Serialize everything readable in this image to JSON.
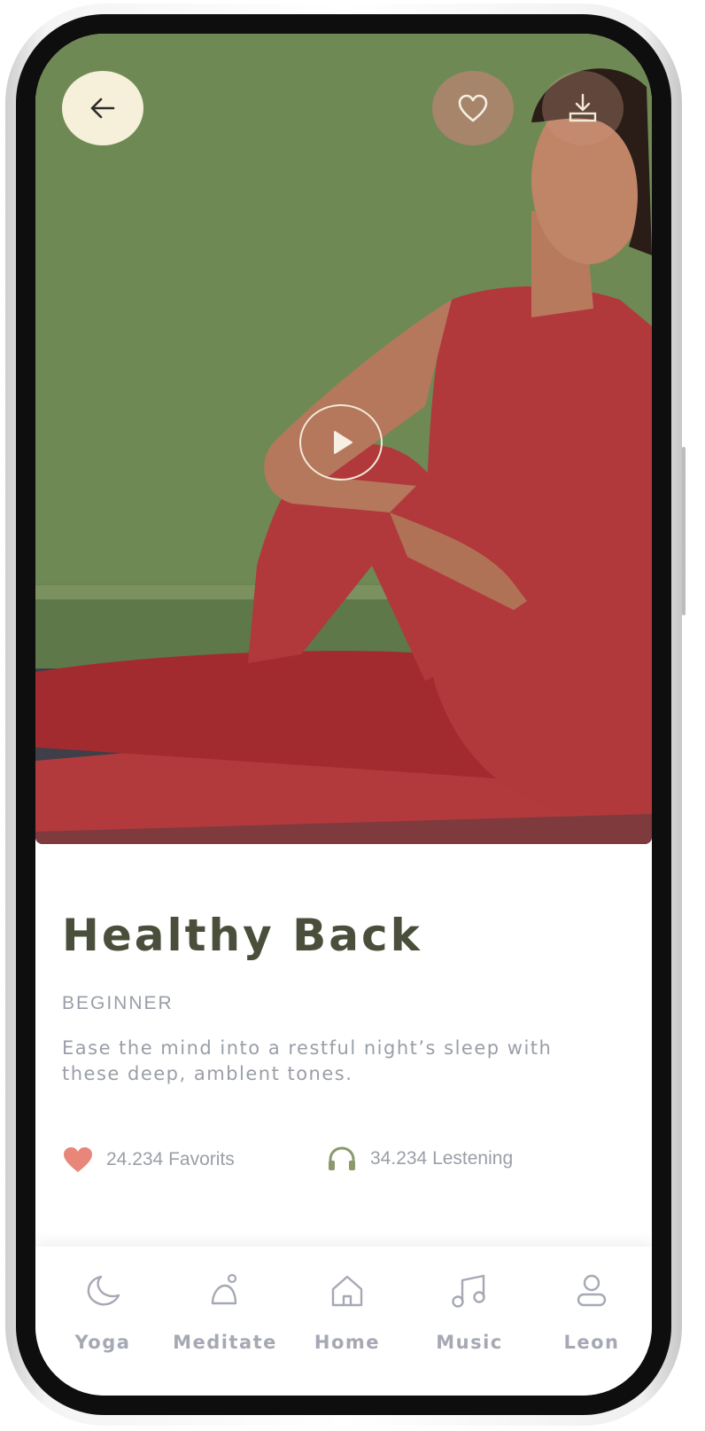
{
  "program": {
    "title": "Healthy Back",
    "level": "BEGINNER",
    "description": "Ease the mind into a restful night’s sleep  with these deep, amblent tones."
  },
  "stats": {
    "favorites": "24.234 Favorits",
    "listening": "34.234 Lestening"
  },
  "nav": {
    "items": [
      {
        "label": "Yoga",
        "icon": "moon-icon"
      },
      {
        "label": "Meditate",
        "icon": "meditate-icon"
      },
      {
        "label": "Home",
        "icon": "home-icon"
      },
      {
        "label": "Music",
        "icon": "music-icon"
      },
      {
        "label": "Leon",
        "icon": "user-icon"
      }
    ]
  },
  "colors": {
    "title": "#4a4f3b",
    "muted_text": "#9a9ea7",
    "back_button_bg": "#f6efd9",
    "heart": "#e8867a",
    "headphones": "#8a9a6c",
    "hero_wall": "#6c8552",
    "outfit": "#b1393c"
  }
}
